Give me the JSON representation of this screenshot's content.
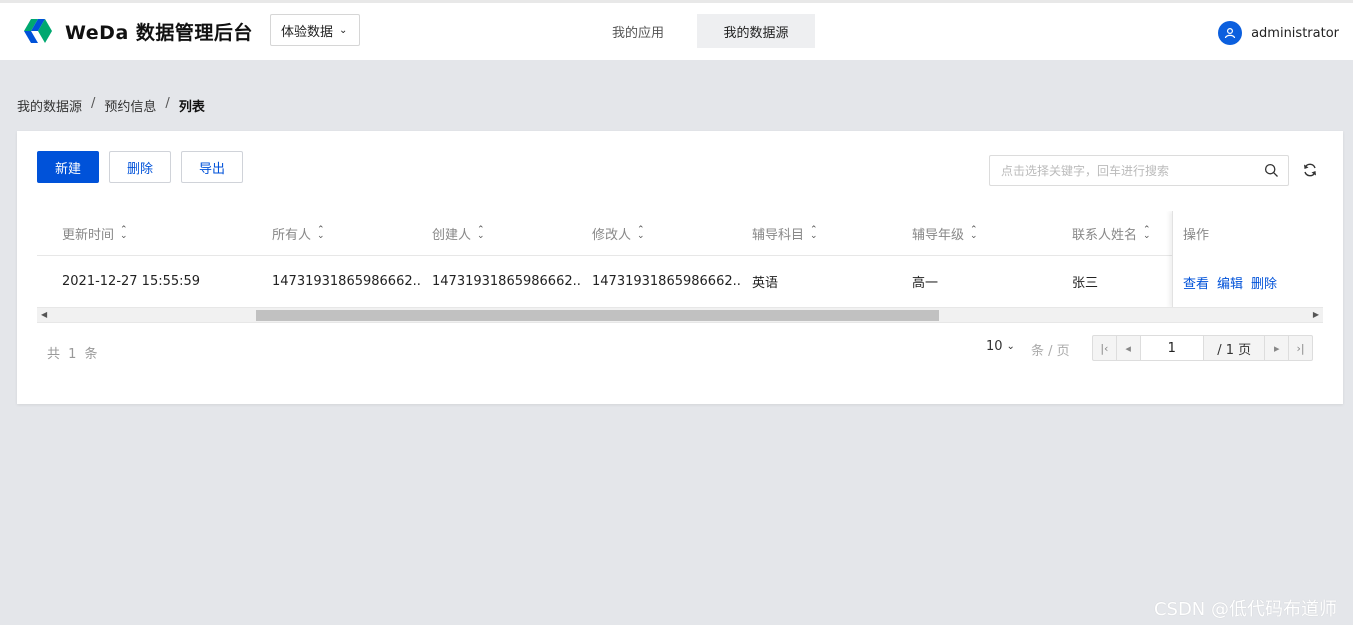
{
  "app": {
    "title": "WeDa 数据管理后台",
    "env_select": "体验数据",
    "nav_tabs": [
      "我的应用",
      "我的数据源"
    ],
    "active_tab": "我的数据源",
    "user": "administrator",
    "accent_color": "#0052d9"
  },
  "breadcrumb": [
    "我的数据源",
    "预约信息",
    "列表"
  ],
  "toolbar": {
    "new_label": "新建",
    "delete_label": "删除",
    "export_label": "导出",
    "search_placeholder": "点击选择关键字，回车进行搜索",
    "refresh_icon": "refresh-icon"
  },
  "table": {
    "columns": [
      "更新时间",
      "所有人",
      "创建人",
      "修改人",
      "辅导科目",
      "辅导年级",
      "联系人姓名"
    ],
    "ops_header": "操作",
    "rows": [
      {
        "cells": [
          "2021-12-27 15:55:59",
          "14731931865986662...",
          "14731931865986662...",
          "14731931865986662...",
          "英语",
          "高一",
          "张三"
        ],
        "actions": [
          "查看",
          "编辑",
          "删除"
        ]
      }
    ]
  },
  "pagination": {
    "total_text": "共 1 条",
    "page_size": "10",
    "per_page_label": "条 / 页",
    "current_page": "1",
    "total_pages": "/ 1 页"
  },
  "watermark": "CSDN @低代码布道师"
}
